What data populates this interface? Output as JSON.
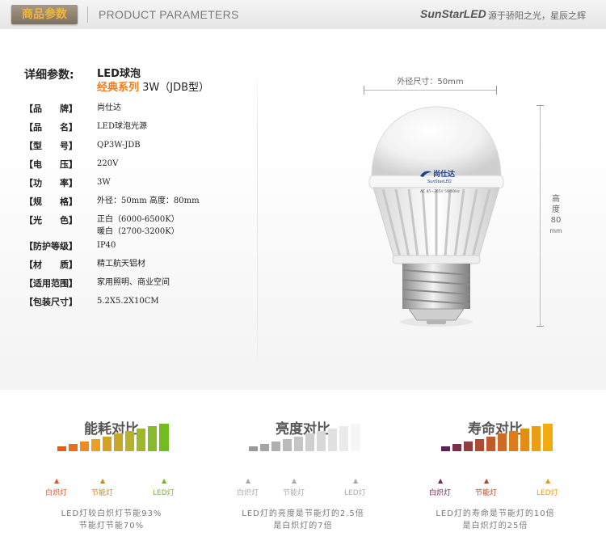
{
  "header": {
    "badge": "商品参数",
    "en_title": "PRODUCT PARAMETERS",
    "brand": "SunStarLED",
    "slogan": "源于骄阳之光，星辰之辉"
  },
  "spec": {
    "title": "详细参数:",
    "model_line1": "LED球泡",
    "model_series": "经典系列",
    "model_rest": " 3W（JDB型）",
    "rows": [
      {
        "key": "【品　　牌】",
        "value": "尚仕达"
      },
      {
        "key": "【品　　名】",
        "value": "LED球泡光源"
      },
      {
        "key": "【型　　号】",
        "value": "QP3W-JDB"
      },
      {
        "key": "【电　　压】",
        "value": "220V"
      },
      {
        "key": "【功　　率】",
        "value": "3W"
      },
      {
        "key": "【规　　格】",
        "value": "外径：50mm 高度：80mm"
      },
      {
        "key": "【光　　色】",
        "value": "正白（6000-6500K）\n暖白（2700-3200K）"
      },
      {
        "key": "【防护等级】",
        "value": "IP40"
      },
      {
        "key": "【材　　质】",
        "value": "精工航天铝材"
      },
      {
        "key": "【适用范围】",
        "value": "家用照明、商业空间"
      },
      {
        "key": "【包装尺寸】",
        "value": "5.2X5.2X10CM"
      }
    ]
  },
  "product": {
    "width_label": "外径尺寸：50mm",
    "height_label_1": "高",
    "height_label_2": "度",
    "height_label_3": "80",
    "height_label_4": "mm",
    "logo_text": "尚仕达",
    "logo_sub": "SunStarLED",
    "spec_text": "AC 85~265V 50/60Hz"
  },
  "comparisons": [
    {
      "title": "能耗对比",
      "labels": [
        "白炽灯",
        "节能灯",
        "LED灯"
      ],
      "label_colors": [
        "#e8561e",
        "#c8861f",
        "#7bb51d"
      ],
      "bar_colors": [
        "#ec5a1a",
        "#ef6d1a",
        "#ee8a24",
        "#e9a024",
        "#d6a224",
        "#c6a92a",
        "#b6b22b",
        "#9fb72b",
        "#87bb2b",
        "#72bc20"
      ],
      "note_1": "LED灯较白炽灯节能93%",
      "note_2": "节能灯节能70%"
    },
    {
      "title": "亮度对比",
      "labels": [
        "白炽灯",
        "节能灯",
        "LED灯"
      ],
      "label_colors": [
        "#aaaaaa",
        "#aaaaaa",
        "#aaaaaa"
      ],
      "bar_colors": [
        "#9a9a9a",
        "#a5a5a5",
        "#b0b0b0",
        "#bbbbbb",
        "#c5c5c5",
        "#cfcfcf",
        "#d8d8d8",
        "#e1e1e1",
        "#eaeaea",
        "#f6f6f6"
      ],
      "note_1": "LED灯的亮度是节能灯的2.5倍",
      "note_2": "是白炽灯的7倍"
    },
    {
      "title": "寿命对比",
      "labels": [
        "白炽灯",
        "节能灯",
        "LED灯"
      ],
      "label_colors": [
        "#6a2b56",
        "#b6422c",
        "#eb9a17"
      ],
      "bar_colors": [
        "#5d2350",
        "#793049",
        "#943d40",
        "#ae4a36",
        "#c1592c",
        "#cf6a24",
        "#db7d1d",
        "#e38d19",
        "#ea9d15",
        "#f1ac12"
      ],
      "note_1": "LED灯的寿命是节能灯的10倍",
      "note_2": "是白炽灯的25倍"
    }
  ]
}
